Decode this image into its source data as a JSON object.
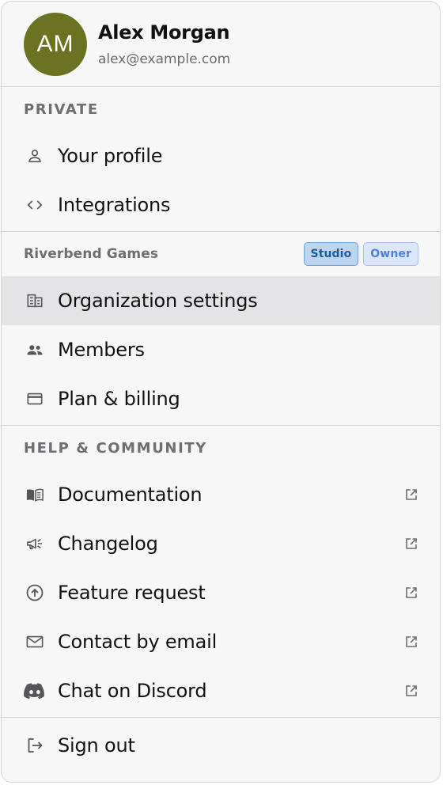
{
  "user": {
    "initials": "AM",
    "name": "Alex Morgan",
    "email": "alex@example.com",
    "avatar_color": "#6b7221"
  },
  "private": {
    "title": "PRIVATE",
    "items": [
      {
        "label": "Your profile",
        "icon": "user-icon"
      },
      {
        "label": "Integrations",
        "icon": "code-icon"
      }
    ]
  },
  "org": {
    "name": "Riverbend Games",
    "badges": [
      "Studio",
      "Owner"
    ],
    "items": [
      {
        "label": "Organization settings",
        "icon": "building-icon",
        "active": true
      },
      {
        "label": "Members",
        "icon": "users-icon"
      },
      {
        "label": "Plan & billing",
        "icon": "credit-card-icon"
      }
    ]
  },
  "help": {
    "title": "HELP & COMMUNITY",
    "items": [
      {
        "label": "Documentation",
        "icon": "book-icon",
        "external": true
      },
      {
        "label": "Changelog",
        "icon": "megaphone-icon",
        "external": true
      },
      {
        "label": "Feature request",
        "icon": "arrow-up-circle-icon",
        "external": true
      },
      {
        "label": "Contact by email",
        "icon": "mail-icon",
        "external": true
      },
      {
        "label": "Chat on Discord",
        "icon": "discord-icon",
        "external": true
      }
    ]
  },
  "footer": {
    "sign_out_label": "Sign out",
    "icon": "sign-out-icon"
  },
  "colors": {
    "active_bg": "#e4e4e6",
    "badge_studio": "#1f5a9c",
    "badge_owner": "#4f7fdc"
  }
}
